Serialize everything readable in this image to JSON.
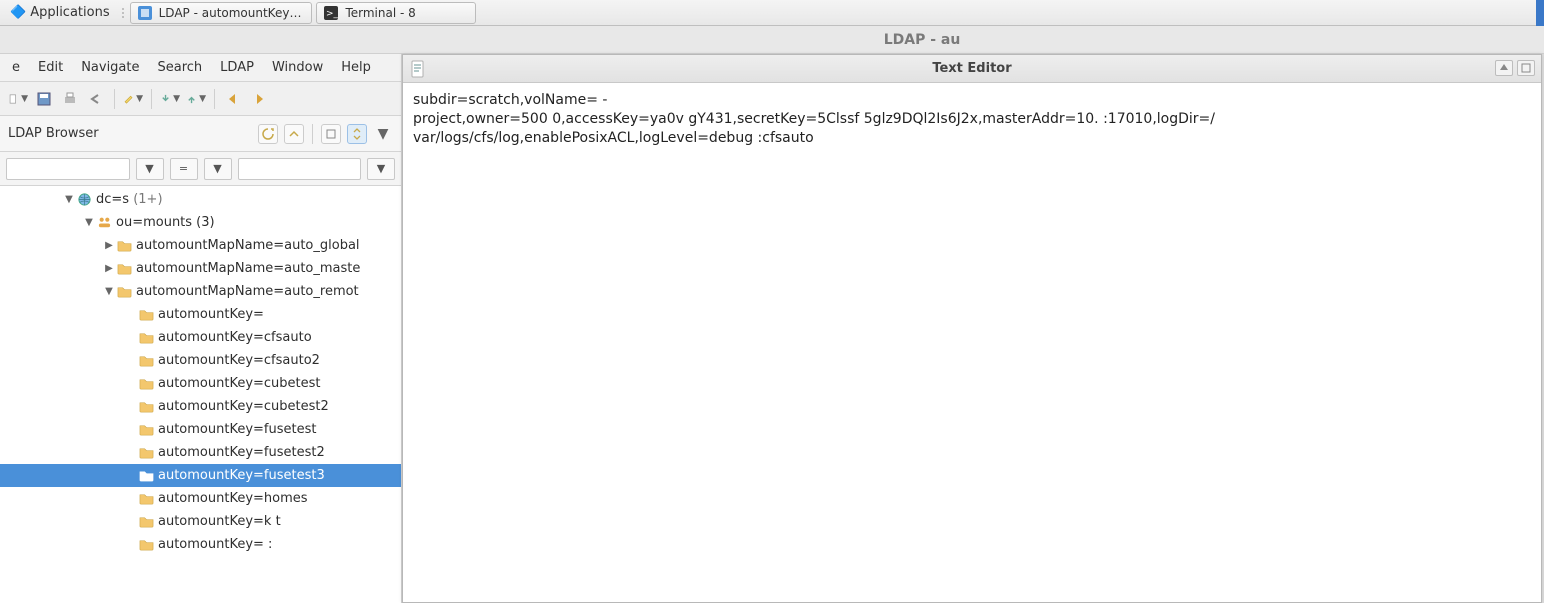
{
  "os_taskbar": {
    "applications_label": "Applications",
    "tasks": [
      {
        "label": "LDAP - automountKey…",
        "icon": "ldap"
      },
      {
        "label": "Terminal - 8",
        "icon": "terminal"
      }
    ]
  },
  "ldap_bg_title": "LDAP - au",
  "ldap": {
    "menu": [
      "e",
      "Edit",
      "Navigate",
      "Search",
      "LDAP",
      "Window",
      "Help"
    ],
    "browser_label": "LDAP Browser",
    "filter_op": "=",
    "tree": {
      "dc_label": "dc=s",
      "dc_suffix": "  (1+)",
      "ou_label": "ou=mounts (3)",
      "maps": [
        {
          "label": "automountMapName=auto_global",
          "expandable": true,
          "expanded": false
        },
        {
          "label": "automountMapName=auto_maste",
          "expandable": true,
          "expanded": false
        },
        {
          "label": "automountMapName=auto_remot",
          "expandable": true,
          "expanded": true,
          "children": [
            "automountKey=",
            "automountKey=cfsauto",
            "automountKey=cfsauto2",
            "automountKey=cubetest",
            "automountKey=cubetest2",
            "automountKey=fusetest",
            "automountKey=fusetest2",
            "automountKey=fusetest3",
            "automountKey=homes",
            "automountKey=k             t",
            "automountKey=            :"
          ],
          "selected_index": 7
        }
      ]
    }
  },
  "texteditor": {
    "title": "Text Editor",
    "content_line1": "subdir=scratch,volName=      -",
    "content_line2": "project,owner=500        0,accessKey=ya0v              gY431,secretKey=5Clssf                          5glz9DQl2Is6J2x,masterAddr=10.             :17010,logDir=/",
    "content_line3": "var/logs/cfs/log,enablePosixACL,logLevel=debug :cfsauto"
  }
}
